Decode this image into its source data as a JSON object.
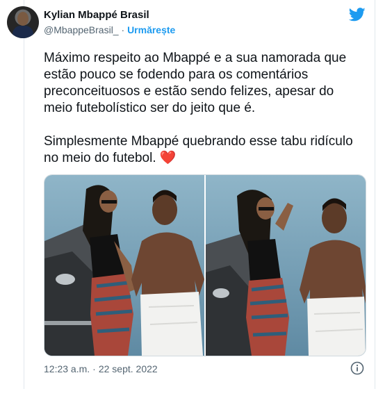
{
  "author": {
    "display_name": "Kylian Mbappé Brasil",
    "handle": "@MbappeBrasil_",
    "separator": "·",
    "follow_label": "Urmărește"
  },
  "tweet": {
    "paragraph1": "Máximo respeito ao Mbappé e a sua namorada que estão pouco se fodendo para os comentários preconceituosos e estão sendo felizes, apesar do meio futebolístico ser do jeito que é.",
    "paragraph2": "Simplesmente Mbappé quebrando esse tabu ridículo no meio do futebol.",
    "emoji": "❤️"
  },
  "media": {
    "count": 2
  },
  "meta": {
    "time": "12:23 a.m.",
    "separator": "·",
    "date": "22 sept. 2022"
  },
  "icons": {
    "brand": "twitter-bird-icon",
    "info": "info-icon"
  },
  "colors": {
    "accent": "#1d9bf0",
    "text": "#0f1419",
    "secondary": "#536471",
    "heart": "#e0245e"
  }
}
